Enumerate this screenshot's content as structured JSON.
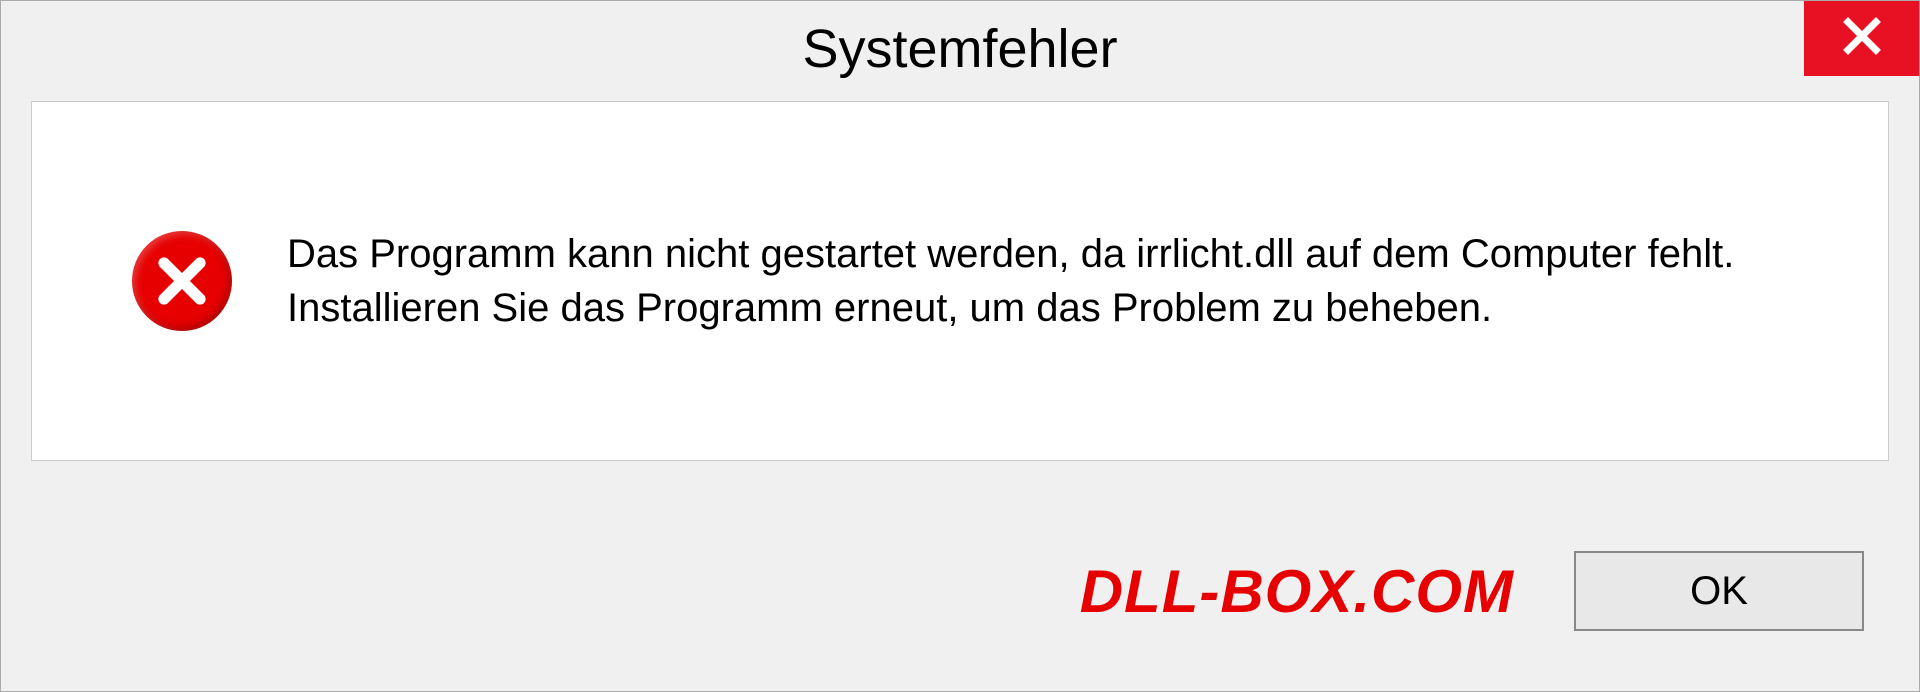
{
  "dialog": {
    "title": "Systemfehler",
    "message": "Das Programm kann nicht gestartet werden, da irrlicht.dll auf dem Computer fehlt. Installieren Sie das Programm erneut, um das Problem zu beheben.",
    "ok_label": "OK"
  },
  "watermark": "DLL-BOX.COM",
  "colors": {
    "close_bg": "#e81123",
    "error_circle": "#e60000",
    "watermark": "#e60000"
  }
}
